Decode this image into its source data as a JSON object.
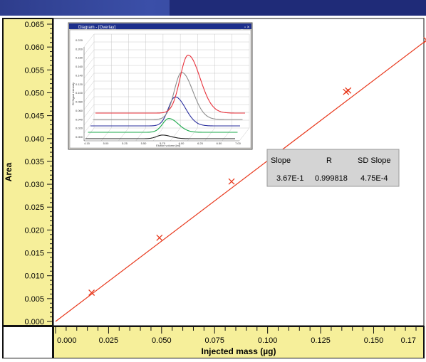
{
  "colors": {
    "ruler_bg": "#f6ef9a",
    "line": "#e8391d",
    "title_bar": "#2e3d8c",
    "table_bg": "#d4d4d4"
  },
  "chart_data": [
    {
      "type": "scatter",
      "title": "",
      "xlabel": "Injected mass (µg)",
      "ylabel": "Area",
      "xlim": [
        0.0,
        0.17
      ],
      "ylim": [
        0.0,
        0.065
      ],
      "x_ticks": [
        0.0,
        0.025,
        0.05,
        0.075,
        0.1,
        0.125,
        0.15,
        0.17
      ],
      "x_tick_labels": [
        "0.000",
        "0.025",
        "0.050",
        "0.075",
        "0.100",
        "0.125",
        "0.150",
        "0.17"
      ],
      "y_ticks": [
        0.0,
        0.005,
        0.01,
        0.015,
        0.02,
        0.025,
        0.03,
        0.035,
        0.04,
        0.045,
        0.05,
        0.055,
        0.06,
        0.065
      ],
      "y_tick_labels": [
        "0.000",
        "0.005",
        "0.010",
        "0.015",
        "0.020",
        "0.025",
        "0.030",
        "0.035",
        "0.040",
        "0.045",
        "0.050",
        "0.055",
        "0.060",
        "0.065"
      ],
      "points": [
        {
          "x": 0.017,
          "y": 0.0063
        },
        {
          "x": 0.049,
          "y": 0.0183
        },
        {
          "x": 0.083,
          "y": 0.0306
        },
        {
          "x": 0.137,
          "y": 0.0502
        },
        {
          "x": 0.138,
          "y": 0.0505
        },
        {
          "x": 0.175,
          "y": 0.0615
        }
      ],
      "fit_line": {
        "x": [
          0.0,
          0.175
        ],
        "y": [
          0.0,
          0.0615
        ]
      },
      "grid": false,
      "stats_table": {
        "headers": [
          "Slope",
          "R",
          "SD Slope"
        ],
        "values": [
          "3.67E-1",
          "0.999818",
          "4.75E-4"
        ]
      }
    },
    {
      "type": "line",
      "title": "Diagram - [Overlay]",
      "xlabel": "Elution volume [ml]",
      "ylabel": "RI Signal intensity",
      "x_tick_labels": [
        "4.15",
        "5.00",
        "5.25",
        "5.50",
        "5.75",
        "6.00",
        "6.25",
        "6.50",
        "7.00"
      ],
      "y_tick_labels": [
        "0.000",
        "0.020",
        "0.040",
        "0.060",
        "0.080",
        "0.100",
        "0.120",
        "0.140",
        "0.160",
        "0.180",
        "0.200",
        "0.220"
      ],
      "series": [
        {
          "color": "#222222",
          "peak_height": 0.01
        },
        {
          "color": "#1aa84a",
          "peak_height": 0.038
        },
        {
          "color": "#2a2f9e",
          "peak_height": 0.08
        },
        {
          "color": "#8c8c8c",
          "peak_height": 0.13
        },
        {
          "color": "#e8303a",
          "peak_height": 0.16
        }
      ]
    }
  ]
}
